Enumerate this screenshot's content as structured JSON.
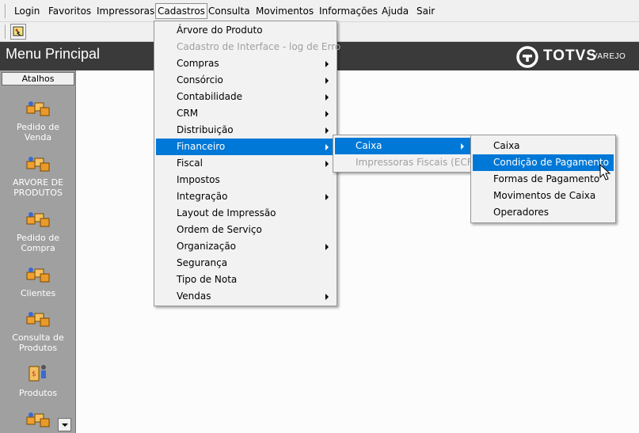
{
  "menubar": {
    "items": [
      "Login",
      "Favoritos",
      "Impressoras",
      "Cadastros",
      "Consulta",
      "Movimentos",
      "Informações",
      "Ajuda",
      "Sair"
    ],
    "active": "Cadastros"
  },
  "toolbar": {
    "button_icon": "shortcut-icon"
  },
  "header": {
    "title": "Menu Principal",
    "logo_brand": "TOTVS",
    "logo_sub": "VAREJO"
  },
  "sidebar": {
    "header": "Atalhos",
    "items": [
      {
        "label": "Pedido de\nVenda",
        "line1": "Pedido de",
        "line2": "Venda"
      },
      {
        "label": "ARVORE DE\nPRODUTOS",
        "line1": "ARVORE DE",
        "line2": "PRODUTOS"
      },
      {
        "label": "Pedido de\nCompra",
        "line1": "Pedido de",
        "line2": "Compra"
      },
      {
        "label": "Clientes",
        "line1": "Clientes",
        "line2": ""
      },
      {
        "label": "Consulta de\nProdutos",
        "line1": "Consulta de",
        "line2": "Produtos"
      },
      {
        "label": "Produtos",
        "line1": "Produtos",
        "line2": ""
      }
    ]
  },
  "cadastros_menu": {
    "items": [
      {
        "label": "Árvore do Produto",
        "submenu": false,
        "disabled": false
      },
      {
        "label": "Cadastro de Interface - log de Erro",
        "submenu": false,
        "disabled": true
      },
      {
        "label": "Compras",
        "submenu": true,
        "disabled": false
      },
      {
        "label": "Consórcio",
        "submenu": true,
        "disabled": false
      },
      {
        "label": "Contabilidade",
        "submenu": true,
        "disabled": false
      },
      {
        "label": "CRM",
        "submenu": true,
        "disabled": false
      },
      {
        "label": "Distribuição",
        "submenu": true,
        "disabled": false
      },
      {
        "label": "Financeiro",
        "submenu": true,
        "disabled": false,
        "highlighted": true
      },
      {
        "label": "Fiscal",
        "submenu": true,
        "disabled": false
      },
      {
        "label": "Impostos",
        "submenu": false,
        "disabled": false
      },
      {
        "label": "Integração",
        "submenu": true,
        "disabled": false
      },
      {
        "label": "Layout de Impressão",
        "submenu": false,
        "disabled": false
      },
      {
        "label": "Ordem de Serviço",
        "submenu": false,
        "disabled": false
      },
      {
        "label": "Organização",
        "submenu": true,
        "disabled": false
      },
      {
        "label": "Segurança",
        "submenu": false,
        "disabled": false
      },
      {
        "label": "Tipo de Nota",
        "submenu": false,
        "disabled": false
      },
      {
        "label": "Vendas",
        "submenu": true,
        "disabled": false
      }
    ]
  },
  "financeiro_menu": {
    "items": [
      {
        "label": "Caixa",
        "submenu": true,
        "disabled": false,
        "highlighted": true
      },
      {
        "label": "Impressoras Fiscais (ECF)",
        "submenu": false,
        "disabled": true
      }
    ]
  },
  "caixa_menu": {
    "items": [
      {
        "label": "Caixa",
        "highlighted": false
      },
      {
        "label": "Condição de Pagamento",
        "highlighted": true
      },
      {
        "label": "Formas de Pagamento",
        "highlighted": false
      },
      {
        "label": "Movimentos de Caixa",
        "highlighted": false
      },
      {
        "label": "Operadores",
        "highlighted": false
      }
    ]
  },
  "colors": {
    "highlight": "#0078d7",
    "header_bg": "#3a3a3a",
    "sidebar_bg": "#a0a0a0"
  }
}
